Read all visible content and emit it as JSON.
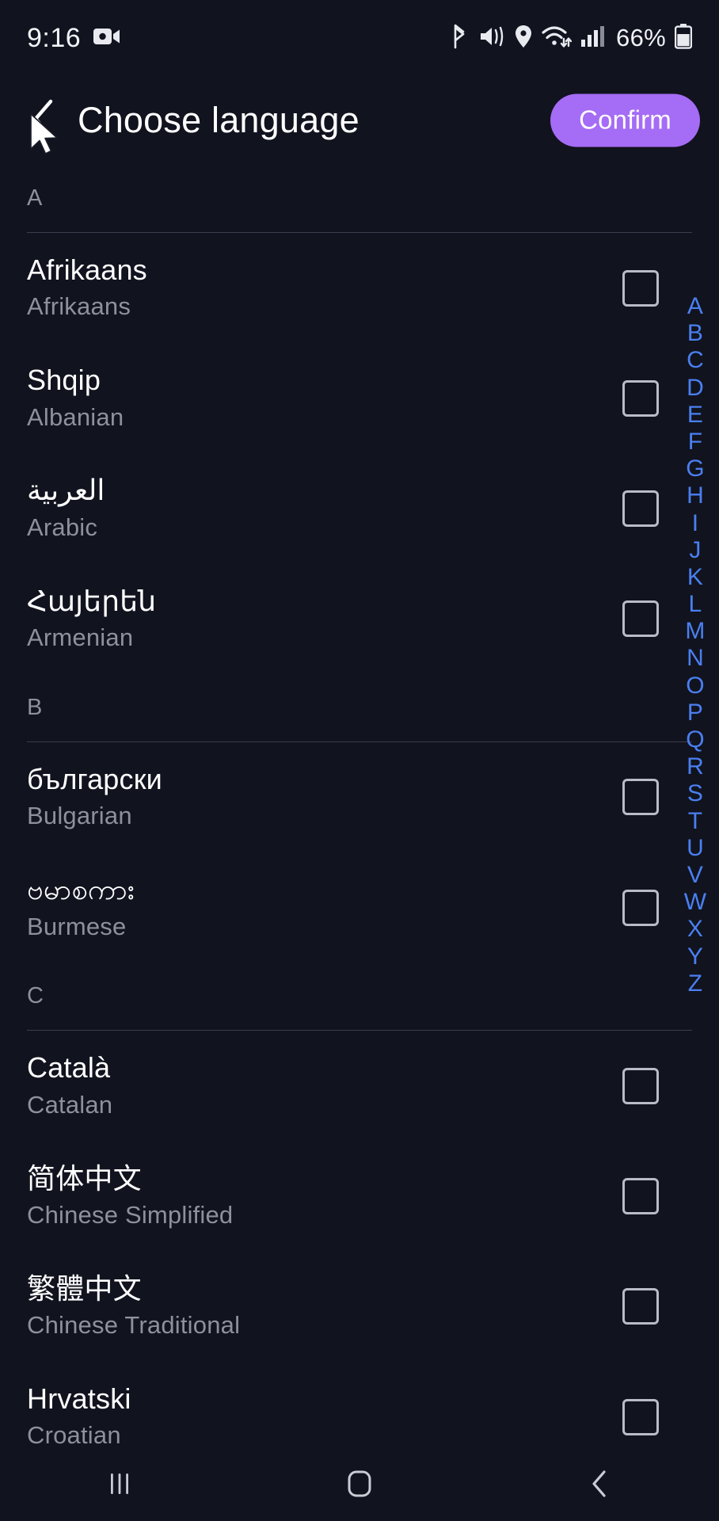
{
  "status_bar": {
    "time": "9:16",
    "battery_percent": "66%",
    "icons": {
      "recording": "video-camera-icon",
      "bluetooth": "bluetooth-icon",
      "sound_off": "mute-vibrate-icon",
      "location": "location-pin-icon",
      "wifi": "wifi-icon",
      "signal": "cellular-signal-icon",
      "battery": "battery-icon"
    }
  },
  "app_bar": {
    "back_icon": "chevron-left-icon",
    "title": "Choose language",
    "confirm_label": "Confirm",
    "confirm_color": "#a56cf5"
  },
  "sections": [
    {
      "letter": "A",
      "languages": [
        {
          "native": "Afrikaans",
          "english": "Afrikaans",
          "checked": false
        },
        {
          "native": "Shqip",
          "english": "Albanian",
          "checked": false
        },
        {
          "native": "العربية",
          "english": "Arabic",
          "checked": false
        },
        {
          "native": "Հայերեն",
          "english": "Armenian",
          "checked": false
        }
      ]
    },
    {
      "letter": "B",
      "languages": [
        {
          "native": "български",
          "english": "Bulgarian",
          "checked": false
        },
        {
          "native": "ဗမာစကား",
          "english": "Burmese",
          "checked": false
        }
      ]
    },
    {
      "letter": "C",
      "languages": [
        {
          "native": "Català",
          "english": "Catalan",
          "checked": false
        },
        {
          "native": "简体中文",
          "english": "Chinese Simplified",
          "checked": false
        },
        {
          "native": "繁體中文",
          "english": "Chinese Traditional",
          "checked": false
        },
        {
          "native": "Hrvatski",
          "english": "Croatian",
          "checked": false
        }
      ]
    }
  ],
  "alphabet_index": {
    "color": "#4a7ff0",
    "letters": [
      "A",
      "B",
      "C",
      "D",
      "E",
      "F",
      "G",
      "H",
      "I",
      "J",
      "K",
      "L",
      "M",
      "N",
      "O",
      "P",
      "Q",
      "R",
      "S",
      "T",
      "U",
      "V",
      "W",
      "X",
      "Y",
      "Z"
    ]
  },
  "nav_bar": {
    "recents_icon": "recents-icon",
    "home_icon": "home-icon",
    "back_icon": "back-icon"
  },
  "cursor": {
    "icon": "mouse-pointer-icon"
  }
}
